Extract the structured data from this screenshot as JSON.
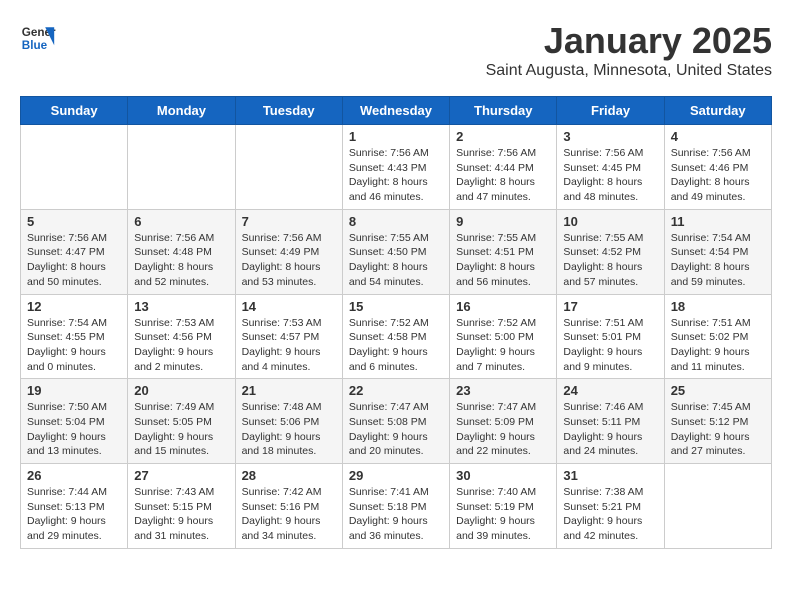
{
  "logo": {
    "line1": "General",
    "line2": "Blue"
  },
  "title": "January 2025",
  "subtitle": "Saint Augusta, Minnesota, United States",
  "days_of_week": [
    "Sunday",
    "Monday",
    "Tuesday",
    "Wednesday",
    "Thursday",
    "Friday",
    "Saturday"
  ],
  "weeks": [
    [
      {
        "day": "",
        "info": ""
      },
      {
        "day": "",
        "info": ""
      },
      {
        "day": "",
        "info": ""
      },
      {
        "day": "1",
        "info": "Sunrise: 7:56 AM\nSunset: 4:43 PM\nDaylight: 8 hours and 46 minutes."
      },
      {
        "day": "2",
        "info": "Sunrise: 7:56 AM\nSunset: 4:44 PM\nDaylight: 8 hours and 47 minutes."
      },
      {
        "day": "3",
        "info": "Sunrise: 7:56 AM\nSunset: 4:45 PM\nDaylight: 8 hours and 48 minutes."
      },
      {
        "day": "4",
        "info": "Sunrise: 7:56 AM\nSunset: 4:46 PM\nDaylight: 8 hours and 49 minutes."
      }
    ],
    [
      {
        "day": "5",
        "info": "Sunrise: 7:56 AM\nSunset: 4:47 PM\nDaylight: 8 hours and 50 minutes."
      },
      {
        "day": "6",
        "info": "Sunrise: 7:56 AM\nSunset: 4:48 PM\nDaylight: 8 hours and 52 minutes."
      },
      {
        "day": "7",
        "info": "Sunrise: 7:56 AM\nSunset: 4:49 PM\nDaylight: 8 hours and 53 minutes."
      },
      {
        "day": "8",
        "info": "Sunrise: 7:55 AM\nSunset: 4:50 PM\nDaylight: 8 hours and 54 minutes."
      },
      {
        "day": "9",
        "info": "Sunrise: 7:55 AM\nSunset: 4:51 PM\nDaylight: 8 hours and 56 minutes."
      },
      {
        "day": "10",
        "info": "Sunrise: 7:55 AM\nSunset: 4:52 PM\nDaylight: 8 hours and 57 minutes."
      },
      {
        "day": "11",
        "info": "Sunrise: 7:54 AM\nSunset: 4:54 PM\nDaylight: 8 hours and 59 minutes."
      }
    ],
    [
      {
        "day": "12",
        "info": "Sunrise: 7:54 AM\nSunset: 4:55 PM\nDaylight: 9 hours and 0 minutes."
      },
      {
        "day": "13",
        "info": "Sunrise: 7:53 AM\nSunset: 4:56 PM\nDaylight: 9 hours and 2 minutes."
      },
      {
        "day": "14",
        "info": "Sunrise: 7:53 AM\nSunset: 4:57 PM\nDaylight: 9 hours and 4 minutes."
      },
      {
        "day": "15",
        "info": "Sunrise: 7:52 AM\nSunset: 4:58 PM\nDaylight: 9 hours and 6 minutes."
      },
      {
        "day": "16",
        "info": "Sunrise: 7:52 AM\nSunset: 5:00 PM\nDaylight: 9 hours and 7 minutes."
      },
      {
        "day": "17",
        "info": "Sunrise: 7:51 AM\nSunset: 5:01 PM\nDaylight: 9 hours and 9 minutes."
      },
      {
        "day": "18",
        "info": "Sunrise: 7:51 AM\nSunset: 5:02 PM\nDaylight: 9 hours and 11 minutes."
      }
    ],
    [
      {
        "day": "19",
        "info": "Sunrise: 7:50 AM\nSunset: 5:04 PM\nDaylight: 9 hours and 13 minutes."
      },
      {
        "day": "20",
        "info": "Sunrise: 7:49 AM\nSunset: 5:05 PM\nDaylight: 9 hours and 15 minutes."
      },
      {
        "day": "21",
        "info": "Sunrise: 7:48 AM\nSunset: 5:06 PM\nDaylight: 9 hours and 18 minutes."
      },
      {
        "day": "22",
        "info": "Sunrise: 7:47 AM\nSunset: 5:08 PM\nDaylight: 9 hours and 20 minutes."
      },
      {
        "day": "23",
        "info": "Sunrise: 7:47 AM\nSunset: 5:09 PM\nDaylight: 9 hours and 22 minutes."
      },
      {
        "day": "24",
        "info": "Sunrise: 7:46 AM\nSunset: 5:11 PM\nDaylight: 9 hours and 24 minutes."
      },
      {
        "day": "25",
        "info": "Sunrise: 7:45 AM\nSunset: 5:12 PM\nDaylight: 9 hours and 27 minutes."
      }
    ],
    [
      {
        "day": "26",
        "info": "Sunrise: 7:44 AM\nSunset: 5:13 PM\nDaylight: 9 hours and 29 minutes."
      },
      {
        "day": "27",
        "info": "Sunrise: 7:43 AM\nSunset: 5:15 PM\nDaylight: 9 hours and 31 minutes."
      },
      {
        "day": "28",
        "info": "Sunrise: 7:42 AM\nSunset: 5:16 PM\nDaylight: 9 hours and 34 minutes."
      },
      {
        "day": "29",
        "info": "Sunrise: 7:41 AM\nSunset: 5:18 PM\nDaylight: 9 hours and 36 minutes."
      },
      {
        "day": "30",
        "info": "Sunrise: 7:40 AM\nSunset: 5:19 PM\nDaylight: 9 hours and 39 minutes."
      },
      {
        "day": "31",
        "info": "Sunrise: 7:38 AM\nSunset: 5:21 PM\nDaylight: 9 hours and 42 minutes."
      },
      {
        "day": "",
        "info": ""
      }
    ]
  ]
}
